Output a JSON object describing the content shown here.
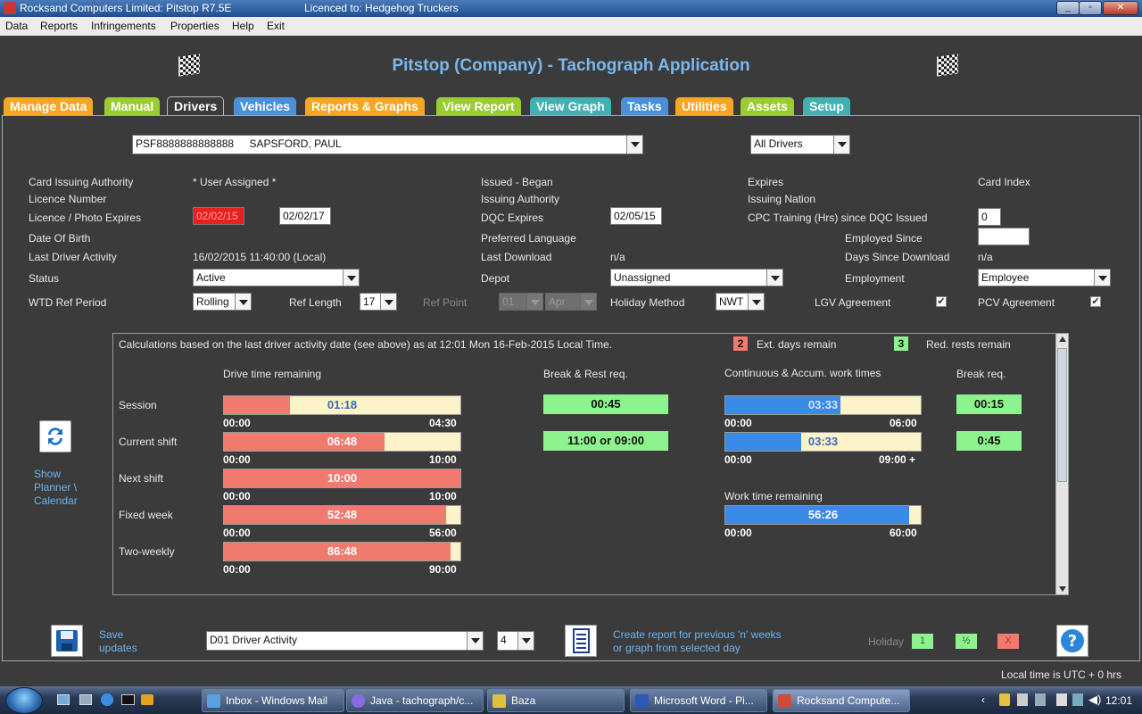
{
  "window": {
    "title": "Rocksand Computers Limited: Pitstop R7.5E",
    "licence": "Licenced to: Hedgehog Truckers"
  },
  "menu": [
    "Data",
    "Reports",
    "Infringements",
    "Properties",
    "Help",
    "Exit"
  ],
  "app_title": "Pitstop (Company) - Tachograph Application",
  "tabs": [
    {
      "label": "Manage Data",
      "color": "#f5a623"
    },
    {
      "label": "Manual",
      "color": "#9acd32"
    },
    {
      "label": "Drivers",
      "color": "#3b3b3b"
    },
    {
      "label": "Vehicles",
      "color": "#4a90d9"
    },
    {
      "label": "Reports & Graphs",
      "color": "#f5a623"
    },
    {
      "label": "View Report",
      "color": "#9acd32"
    },
    {
      "label": "View Graph",
      "color": "#40b0b0"
    },
    {
      "label": "Tasks",
      "color": "#4a90d9"
    },
    {
      "label": "Utilities",
      "color": "#f5a623"
    },
    {
      "label": "Assets",
      "color": "#9acd32"
    },
    {
      "label": "Setup",
      "color": "#40b0b0"
    }
  ],
  "driver_select": {
    "id": "PSF8888888888888",
    "name": "SAPSFORD, PAUL"
  },
  "filter_select": "All Drivers",
  "details": {
    "card_issuing_authority_label": "Card Issuing Authority",
    "card_issuing_authority_value": "* User Assigned *",
    "issued_began_label": "Issued - Began",
    "expires_label": "Expires",
    "card_index_label": "Card Index",
    "licence_number_label": "Licence Number",
    "issuing_authority_label": "Issuing Authority",
    "issuing_nation_label": "Issuing Nation",
    "licence_photo_expires_label": "Licence / Photo Expires",
    "licence_expires_value": "02/02/15",
    "photo_expires_value": "02/02/17",
    "dqc_expires_label": "DQC Expires",
    "dqc_expires_value": "02/05/15",
    "cpc_label": "CPC Training (Hrs) since DQC Issued",
    "cpc_value": "0",
    "dob_label": "Date Of Birth",
    "preferred_language_label": "Preferred Language",
    "employed_since_label": "Employed Since",
    "employed_since_value": "",
    "last_activity_label": "Last Driver Activity",
    "last_activity_value": "16/02/2015 11:40:00 (Local)",
    "last_download_label": "Last Download",
    "last_download_value": "n/a",
    "days_since_download_label": "Days Since Download",
    "days_since_download_value": "n/a",
    "status_label": "Status",
    "status_value": "Active",
    "depot_label": "Depot",
    "depot_value": "Unassigned",
    "employment_label": "Employment",
    "employment_value": "Employee",
    "wtd_label": "WTD Ref Period",
    "wtd_value": "Rolling",
    "ref_length_label": "Ref Length",
    "ref_length_value": "17",
    "ref_point_label": "Ref Point",
    "ref_point_day": "01",
    "ref_point_month": "Apr",
    "holiday_method_label": "Holiday Method",
    "holiday_method_value": "NWT",
    "lgv_label": "LGV Agreement",
    "pcv_label": "PCV Agreement",
    "check_mark": "✔"
  },
  "calc": {
    "header": "Calculations based on the last driver activity date (see above) as at 12:01 Mon 16-Feb-2015 Local Time.",
    "ext_days_count": "2",
    "ext_days_label": "Ext. days remain",
    "red_rests_count": "3",
    "red_rests_label": "Red. rests remain",
    "drive_time_heading": "Drive time remaining",
    "break_rest_heading": "Break & Rest req.",
    "continuous_heading": "Continuous & Accum. work times",
    "break_req_heading": "Break req.",
    "work_time_heading": "Work time remaining",
    "rows": [
      {
        "label": "Session",
        "value": "01:18",
        "fraction": 0.28,
        "min": "00:00",
        "max": "04:30"
      },
      {
        "label": "Current shift",
        "value": "06:48",
        "fraction": 0.68,
        "min": "00:00",
        "max": "10:00"
      },
      {
        "label": "Next shift",
        "value": "10:00",
        "fraction": 1.0,
        "min": "00:00",
        "max": "10:00"
      },
      {
        "label": "Fixed week",
        "value": "52:48",
        "fraction": 0.94,
        "min": "00:00",
        "max": "56:00"
      },
      {
        "label": "Two-weekly",
        "value": "86:48",
        "fraction": 0.96,
        "min": "00:00",
        "max": "90:00"
      }
    ],
    "break_rest": [
      "00:45",
      "11:00 or 09:00"
    ],
    "continuous": [
      {
        "value": "03:33",
        "fraction": 0.59,
        "min": "00:00",
        "max": "06:00"
      },
      {
        "value": "03:33",
        "fraction": 0.39,
        "min": "00:00",
        "max": "09:00 +"
      }
    ],
    "break_req": [
      "00:15",
      "0:45"
    ],
    "work_time": {
      "value": "56:26",
      "fraction": 0.94,
      "min": "00:00",
      "max": "60:00"
    }
  },
  "show_planner": "Show Planner \\ Calendar",
  "footer": {
    "save_label": "Save updates",
    "report_select": "D01 Driver Activity",
    "weeks_select": "4",
    "create_report_text": "Create report for previous 'n' weeks or graph from selected day",
    "holiday_label": "Holiday",
    "holiday_btns": [
      "1",
      "½",
      "X"
    ]
  },
  "status_text": "Local time is UTC + 0 hrs",
  "taskbar": {
    "items": [
      "Inbox - Windows Mail",
      "Java - tachograph/c...",
      "Baza",
      "Microsoft Word - Pi...",
      "Rocksand Compute..."
    ],
    "clock": "12:01"
  }
}
